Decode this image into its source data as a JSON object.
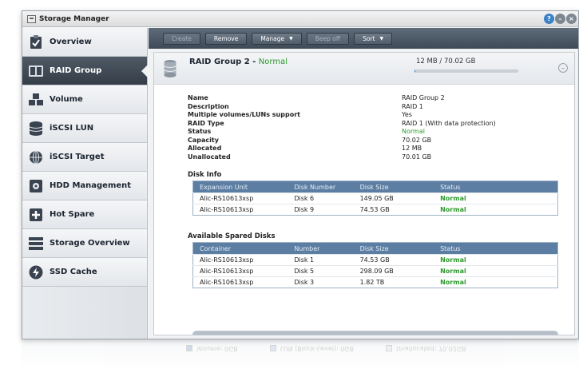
{
  "window": {
    "title": "Storage Manager"
  },
  "sidebar": {
    "items": [
      {
        "label": "Overview",
        "icon": "clipboard-check-icon"
      },
      {
        "label": "RAID Group",
        "icon": "raid-disks-icon",
        "active": true
      },
      {
        "label": "Volume",
        "icon": "volume-cubes-icon"
      },
      {
        "label": "iSCSI LUN",
        "icon": "database-icon"
      },
      {
        "label": "iSCSI Target",
        "icon": "globe-icon"
      },
      {
        "label": "HDD Management",
        "icon": "hdd-icon"
      },
      {
        "label": "Hot Spare",
        "icon": "plus-box-icon"
      },
      {
        "label": "Storage Overview",
        "icon": "storage-stack-icon"
      },
      {
        "label": "SSD Cache",
        "icon": "lightning-icon"
      }
    ]
  },
  "toolbar": {
    "create": "Create",
    "remove": "Remove",
    "manage": "Manage",
    "beep_off": "Beep off",
    "sort": "Sort"
  },
  "group": {
    "title": "RAID Group 2 - ",
    "status": "Normal",
    "usage": "12 MB / 70.02 GB",
    "usage_fraction": 0.0002
  },
  "properties": [
    {
      "key": "Name",
      "value": "RAID Group 2"
    },
    {
      "key": "Description",
      "value": "RAID 1"
    },
    {
      "key": "Multiple volumes/LUNs support",
      "value": "Yes"
    },
    {
      "key": "RAID Type",
      "value": "RAID 1 (With data protection)"
    },
    {
      "key": "Status",
      "value": "Normal",
      "ok": true
    },
    {
      "key": "Capacity",
      "value": "70.02 GB"
    },
    {
      "key": "Allocated",
      "value": "12 MB"
    },
    {
      "key": "Unallocated",
      "value": "70.01 GB"
    }
  ],
  "disk_info": {
    "title": "Disk Info",
    "columns": [
      "Expansion Unit",
      "Disk Number",
      "Disk Size",
      "Status"
    ],
    "rows": [
      [
        "Alic-RS10613xsp",
        "Disk 6",
        "149.05 GB",
        "Normal"
      ],
      [
        "Alic-RS10613xsp",
        "Disk 9",
        "74.53 GB",
        "Normal"
      ]
    ]
  },
  "spared_disks": {
    "title": "Available Spared Disks",
    "columns": [
      "Container",
      "Number",
      "Disk Size",
      "Status"
    ],
    "rows": [
      [
        "Alic-RS10613xsp",
        "Disk 1",
        "74.53 GB",
        "Normal"
      ],
      [
        "Alic-RS10613xsp",
        "Disk 5",
        "298.09 GB",
        "Normal"
      ],
      [
        "Alic-RS10613xsp",
        "Disk 3",
        "1.82 TB",
        "Normal"
      ]
    ]
  },
  "legend": {
    "volume": "Volume: 0GB",
    "lun": "LUN (Block-Level): 0GB",
    "unallocated": "Unallocated: 70.02GB"
  },
  "colors": {
    "volume": "#2f5f95",
    "lun": "#6f93c2",
    "unallocated": "#b9c2cc",
    "normal": "#2c9a2c"
  }
}
